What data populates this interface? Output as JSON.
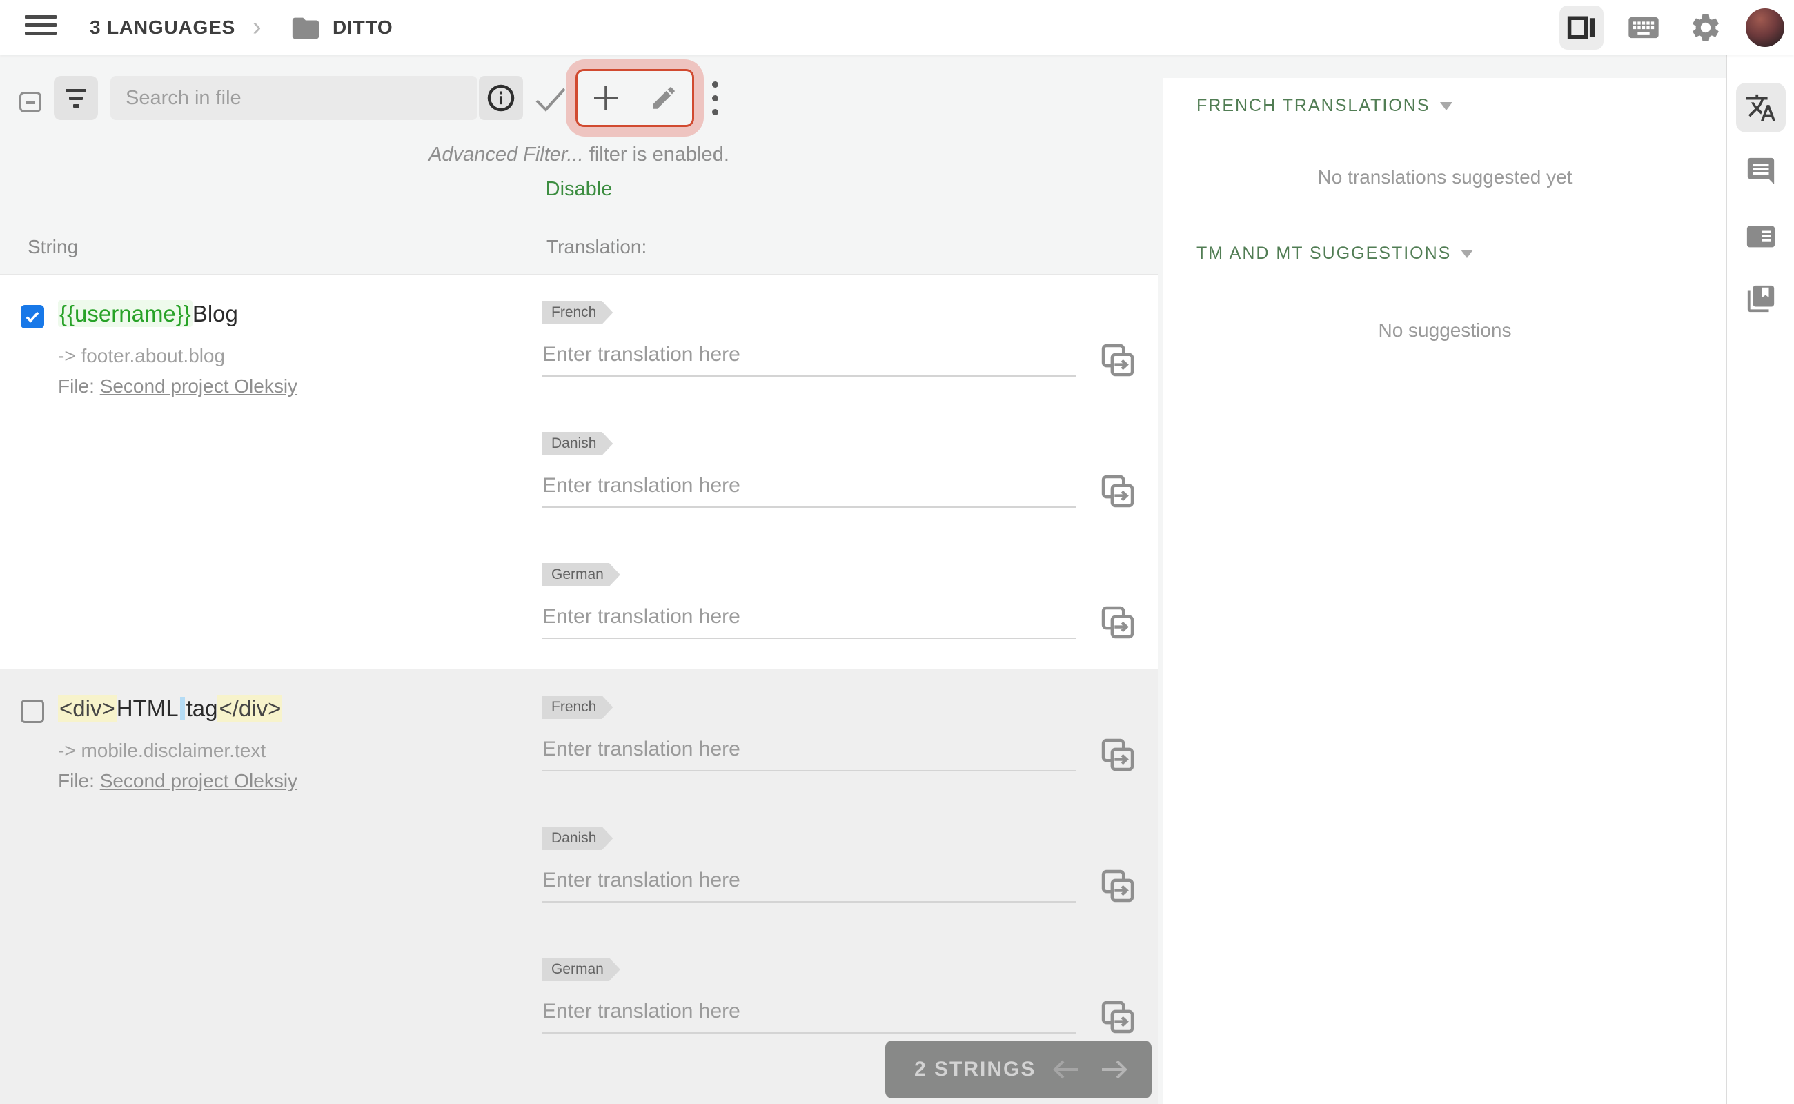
{
  "topbar": {
    "breadcrumb_root": "3 LANGUAGES",
    "breadcrumb_current": "DITTO"
  },
  "toolbar": {
    "search_placeholder": "Search in file"
  },
  "filter_notice": {
    "filter_name": "Advanced Filter...",
    "suffix": " filter is enabled.",
    "action": "Disable"
  },
  "table_header": {
    "string_col": "String",
    "translation_col": "Translation:"
  },
  "ui": {
    "enter_placeholder": "Enter translation here"
  },
  "rows": [
    {
      "checked": true,
      "string_parts": {
        "token": "{{username}}",
        "text": "Blog"
      },
      "key": "-> footer.about.blog",
      "file_label": "File:",
      "file_link": "Second project Oleksiy",
      "translations": [
        {
          "lang": "French"
        },
        {
          "lang": "Danish"
        },
        {
          "lang": "German"
        }
      ]
    },
    {
      "checked": false,
      "string_parts": {
        "open_tag": "<div>",
        "text_a": "HTML",
        "text_b": "tag",
        "close_tag": "</div>"
      },
      "key": "-> mobile.disclaimer.text",
      "file_label": "File:",
      "file_link": "Second project Oleksiy",
      "translations": [
        {
          "lang": "French"
        },
        {
          "lang": "Danish"
        },
        {
          "lang": "German"
        }
      ]
    }
  ],
  "pagination": {
    "label": "2 STRINGS"
  },
  "right_panel": {
    "sections": [
      {
        "title": "FRENCH TRANSLATIONS",
        "empty": "No translations suggested yet"
      },
      {
        "title": "TM AND MT SUGGESTIONS",
        "empty": "No suggestions"
      }
    ]
  },
  "colors": {
    "accent_green": "#3c8d40",
    "heading_green": "#517d54",
    "checkbox_blue": "#1878e8",
    "highlight_red": "#d14a30",
    "token_green": "#28a228",
    "tag_yellow": "#f7f3cb"
  }
}
